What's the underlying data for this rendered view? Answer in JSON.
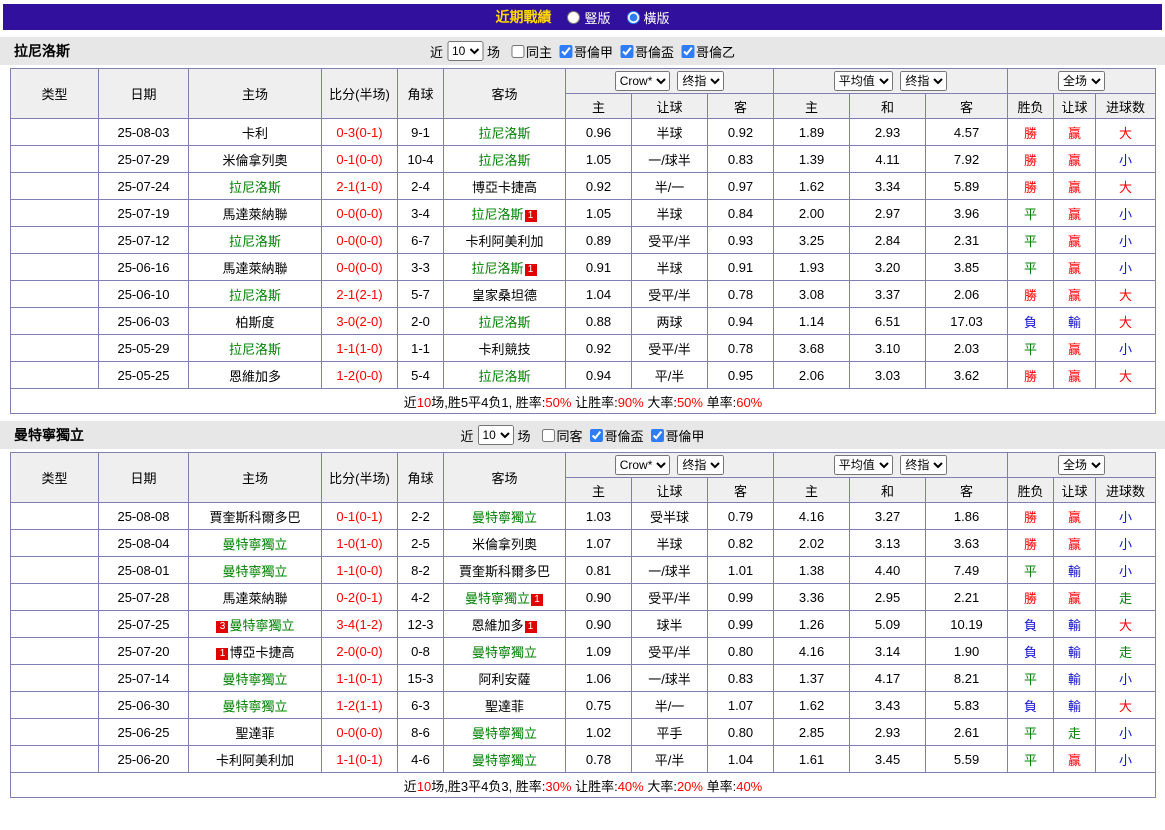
{
  "topbar": {
    "title": "近期戰績",
    "radio_vertical": "豎版",
    "radio_horizontal": "橫版",
    "vertical_checked": false,
    "horizontal_checked": true
  },
  "colors": {
    "topbar_bg": "#30109c",
    "title_yellow": "#ffd800",
    "league_jia_red": "#d8102c",
    "league_bei_magenta": "#cc00cc",
    "win_red": "#ff0000",
    "draw_green": "#008000",
    "loss_blue": "#1414cc"
  },
  "columns": {
    "type": "类型",
    "date": "日期",
    "home": "主场",
    "score": "比分(半场)",
    "corner": "角球",
    "away": "客场",
    "h": "主",
    "line": "让球",
    "a": "客",
    "h2": "主",
    "d": "和",
    "a2": "客",
    "res": "胜负",
    "let": "让球",
    "goals": "进球数"
  },
  "selects": {
    "company": "Crow*",
    "final": "终指",
    "avg": "平均值",
    "final2": "终指",
    "scope": "全场"
  },
  "sections": [
    {
      "team": "拉尼洛斯",
      "near_label": "近",
      "rounds": "10",
      "field_label": "场",
      "filters": [
        {
          "label": "同主",
          "checked": false
        },
        {
          "label": "哥倫甲",
          "checked": true
        },
        {
          "label": "哥倫盃",
          "checked": true
        },
        {
          "label": "哥倫乙",
          "checked": true
        }
      ],
      "rows": [
        {
          "league": "哥倫甲",
          "cup": false,
          "date": "25-08-03",
          "home": {
            "name": "卡利"
          },
          "score": "0-3(0-1)",
          "corners": "9-1",
          "away": {
            "name": "拉尼洛斯",
            "green": true
          },
          "odds": [
            "0.96",
            "半球",
            "0.92",
            "1.89",
            "2.93",
            "4.57"
          ],
          "res": {
            "t": "勝",
            "c": "r"
          },
          "let": {
            "t": "赢",
            "c": "r"
          },
          "goal": {
            "t": "大",
            "c": "r"
          }
        },
        {
          "league": "哥倫甲",
          "cup": false,
          "date": "25-07-29",
          "home": {
            "name": "米倫拿列奧"
          },
          "score": "0-1(0-0)",
          "corners": "10-4",
          "away": {
            "name": "拉尼洛斯",
            "green": true
          },
          "odds": [
            "1.05",
            "一/球半",
            "0.83",
            "1.39",
            "4.11",
            "7.92"
          ],
          "res": {
            "t": "勝",
            "c": "r"
          },
          "let": {
            "t": "赢",
            "c": "r"
          },
          "goal": {
            "t": "小",
            "c": "b"
          }
        },
        {
          "league": "哥倫甲",
          "cup": false,
          "date": "25-07-24",
          "home": {
            "name": "拉尼洛斯",
            "green": true
          },
          "score": "2-1(1-0)",
          "corners": "2-4",
          "away": {
            "name": "博亞卡捷高"
          },
          "odds": [
            "0.92",
            "半/一",
            "0.97",
            "1.62",
            "3.34",
            "5.89"
          ],
          "res": {
            "t": "勝",
            "c": "r"
          },
          "let": {
            "t": "赢",
            "c": "r"
          },
          "goal": {
            "t": "大",
            "c": "r"
          }
        },
        {
          "league": "哥倫甲",
          "cup": false,
          "date": "25-07-19",
          "home": {
            "name": "馬達萊納聯"
          },
          "score": "0-0(0-0)",
          "corners": "3-4",
          "away": {
            "name": "拉尼洛斯",
            "green": true,
            "rc_after": "1"
          },
          "odds": [
            "1.05",
            "半球",
            "0.84",
            "2.00",
            "2.97",
            "3.96"
          ],
          "res": {
            "t": "平",
            "c": "g"
          },
          "let": {
            "t": "赢",
            "c": "r"
          },
          "goal": {
            "t": "小",
            "c": "b"
          }
        },
        {
          "league": "哥倫甲",
          "cup": false,
          "date": "25-07-12",
          "home": {
            "name": "拉尼洛斯",
            "green": true
          },
          "score": "0-0(0-0)",
          "corners": "6-7",
          "away": {
            "name": "卡利阿美利加"
          },
          "odds": [
            "0.89",
            "受平/半",
            "0.93",
            "3.25",
            "2.84",
            "2.31"
          ],
          "res": {
            "t": "平",
            "c": "g"
          },
          "let": {
            "t": "赢",
            "c": "r"
          },
          "goal": {
            "t": "小",
            "c": "b"
          }
        },
        {
          "league": "哥倫盃",
          "cup": true,
          "date": "25-06-16",
          "home": {
            "name": "馬達萊納聯"
          },
          "score": "0-0(0-0)",
          "corners": "3-3",
          "away": {
            "name": "拉尼洛斯",
            "green": true,
            "rc_after": "1"
          },
          "odds": [
            "0.91",
            "半球",
            "0.91",
            "1.93",
            "3.20",
            "3.85"
          ],
          "res": {
            "t": "平",
            "c": "g"
          },
          "let": {
            "t": "赢",
            "c": "r"
          },
          "goal": {
            "t": "小",
            "c": "b"
          }
        },
        {
          "league": "哥倫甲",
          "cup": false,
          "date": "25-06-10",
          "home": {
            "name": "拉尼洛斯",
            "green": true
          },
          "score": "2-1(2-1)",
          "corners": "5-7",
          "away": {
            "name": "皇家桑坦德"
          },
          "odds": [
            "1.04",
            "受平/半",
            "0.78",
            "3.08",
            "3.37",
            "2.06"
          ],
          "res": {
            "t": "勝",
            "c": "r"
          },
          "let": {
            "t": "赢",
            "c": "r"
          },
          "goal": {
            "t": "大",
            "c": "r"
          }
        },
        {
          "league": "哥倫盃",
          "cup": true,
          "date": "25-06-03",
          "home": {
            "name": "柏斯度"
          },
          "score": "3-0(2-0)",
          "corners": "2-0",
          "away": {
            "name": "拉尼洛斯",
            "green": true
          },
          "odds": [
            "0.88",
            "两球",
            "0.94",
            "1.14",
            "6.51",
            "17.03"
          ],
          "res": {
            "t": "負",
            "c": "b"
          },
          "let": {
            "t": "輸",
            "c": "b"
          },
          "goal": {
            "t": "大",
            "c": "r"
          }
        },
        {
          "league": "哥倫盃",
          "cup": true,
          "date": "25-05-29",
          "home": {
            "name": "拉尼洛斯",
            "green": true
          },
          "score": "1-1(1-0)",
          "corners": "1-1",
          "away": {
            "name": "卡利競技"
          },
          "odds": [
            "0.92",
            "受平/半",
            "0.78",
            "3.68",
            "3.10",
            "2.03"
          ],
          "res": {
            "t": "平",
            "c": "g"
          },
          "let": {
            "t": "赢",
            "c": "r"
          },
          "goal": {
            "t": "小",
            "c": "b"
          }
        },
        {
          "league": "哥倫甲",
          "cup": false,
          "date": "25-05-25",
          "home": {
            "name": "恩維加多"
          },
          "score": "1-2(0-0)",
          "corners": "5-4",
          "away": {
            "name": "拉尼洛斯",
            "green": true
          },
          "odds": [
            "0.94",
            "平/半",
            "0.95",
            "2.06",
            "3.03",
            "3.62"
          ],
          "res": {
            "t": "勝",
            "c": "r"
          },
          "let": {
            "t": "赢",
            "c": "r"
          },
          "goal": {
            "t": "大",
            "c": "r"
          }
        }
      ],
      "summary": [
        {
          "t": "近"
        },
        {
          "t": "10",
          "c": "r"
        },
        {
          "t": "场,胜5平4负1, 胜率:"
        },
        {
          "t": "50%",
          "c": "r"
        },
        {
          "t": " 让胜率:"
        },
        {
          "t": "90%",
          "c": "r"
        },
        {
          "t": " 大率:"
        },
        {
          "t": "50%",
          "c": "r"
        },
        {
          "t": " 单率:"
        },
        {
          "t": "60%",
          "c": "r"
        }
      ]
    },
    {
      "team": "曼特寧獨立",
      "near_label": "近",
      "rounds": "10",
      "field_label": "场",
      "filters": [
        {
          "label": "同客",
          "checked": false
        },
        {
          "label": "哥倫盃",
          "checked": true
        },
        {
          "label": "哥倫甲",
          "checked": true
        }
      ],
      "rows": [
        {
          "league": "哥倫盃",
          "cup": true,
          "date": "25-08-08",
          "home": {
            "name": "賈奎斯科爾多巴"
          },
          "score": "0-1(0-1)",
          "corners": "2-2",
          "away": {
            "name": "曼特寧獨立",
            "green": true
          },
          "odds": [
            "1.03",
            "受半球",
            "0.79",
            "4.16",
            "3.27",
            "1.86"
          ],
          "res": {
            "t": "勝",
            "c": "r"
          },
          "let": {
            "t": "赢",
            "c": "r"
          },
          "goal": {
            "t": "小",
            "c": "b"
          }
        },
        {
          "league": "哥倫甲",
          "cup": false,
          "date": "25-08-04",
          "home": {
            "name": "曼特寧獨立",
            "green": true
          },
          "score": "1-0(1-0)",
          "corners": "2-5",
          "away": {
            "name": "米倫拿列奧"
          },
          "odds": [
            "1.07",
            "半球",
            "0.82",
            "2.02",
            "3.13",
            "3.63"
          ],
          "res": {
            "t": "勝",
            "c": "r"
          },
          "let": {
            "t": "赢",
            "c": "r"
          },
          "goal": {
            "t": "小",
            "c": "b"
          }
        },
        {
          "league": "哥倫盃",
          "cup": true,
          "date": "25-08-01",
          "home": {
            "name": "曼特寧獨立",
            "green": true
          },
          "score": "1-1(0-0)",
          "corners": "8-2",
          "away": {
            "name": "賈奎斯科爾多巴"
          },
          "odds": [
            "0.81",
            "一/球半",
            "1.01",
            "1.38",
            "4.40",
            "7.49"
          ],
          "res": {
            "t": "平",
            "c": "g"
          },
          "let": {
            "t": "輸",
            "c": "b"
          },
          "goal": {
            "t": "小",
            "c": "b"
          }
        },
        {
          "league": "哥倫甲",
          "cup": false,
          "date": "25-07-28",
          "home": {
            "name": "馬達萊納聯"
          },
          "score": "0-2(0-1)",
          "corners": "4-2",
          "away": {
            "name": "曼特寧獨立",
            "green": true,
            "rc_after": "1"
          },
          "odds": [
            "0.90",
            "受平/半",
            "0.99",
            "3.36",
            "2.95",
            "2.21"
          ],
          "res": {
            "t": "勝",
            "c": "r"
          },
          "let": {
            "t": "赢",
            "c": "r"
          },
          "goal": {
            "t": "走",
            "c": "g"
          }
        },
        {
          "league": "哥倫甲",
          "cup": false,
          "date": "25-07-25",
          "home": {
            "name": "曼特寧獨立",
            "green": true,
            "rc_before": "3"
          },
          "score": "3-4(1-2)",
          "corners": "12-3",
          "away": {
            "name": "恩維加多",
            "rc_after": "1"
          },
          "odds": [
            "0.90",
            "球半",
            "0.99",
            "1.26",
            "5.09",
            "10.19"
          ],
          "res": {
            "t": "負",
            "c": "b"
          },
          "let": {
            "t": "輸",
            "c": "b"
          },
          "goal": {
            "t": "大",
            "c": "r"
          }
        },
        {
          "league": "哥倫甲",
          "cup": false,
          "date": "25-07-20",
          "home": {
            "name": "博亞卡捷高",
            "rc_before": "1"
          },
          "score": "2-0(0-0)",
          "corners": "0-8",
          "away": {
            "name": "曼特寧獨立",
            "green": true
          },
          "odds": [
            "1.09",
            "受平/半",
            "0.80",
            "4.16",
            "3.14",
            "1.90"
          ],
          "res": {
            "t": "負",
            "c": "b"
          },
          "let": {
            "t": "輸",
            "c": "b"
          },
          "goal": {
            "t": "走",
            "c": "g"
          }
        },
        {
          "league": "哥倫甲",
          "cup": false,
          "date": "25-07-14",
          "home": {
            "name": "曼特寧獨立",
            "green": true
          },
          "score": "1-1(0-1)",
          "corners": "15-3",
          "away": {
            "name": "阿利安薩"
          },
          "odds": [
            "1.06",
            "一/球半",
            "0.83",
            "1.37",
            "4.17",
            "8.21"
          ],
          "res": {
            "t": "平",
            "c": "g"
          },
          "let": {
            "t": "輸",
            "c": "b"
          },
          "goal": {
            "t": "小",
            "c": "b"
          }
        },
        {
          "league": "哥倫甲",
          "cup": false,
          "date": "25-06-30",
          "home": {
            "name": "曼特寧獨立",
            "green": true
          },
          "score": "1-2(1-1)",
          "corners": "6-3",
          "away": {
            "name": "聖達菲"
          },
          "odds": [
            "0.75",
            "半/一",
            "1.07",
            "1.62",
            "3.43",
            "5.83"
          ],
          "res": {
            "t": "負",
            "c": "b"
          },
          "let": {
            "t": "輸",
            "c": "b"
          },
          "goal": {
            "t": "大",
            "c": "r"
          }
        },
        {
          "league": "哥倫甲",
          "cup": false,
          "date": "25-06-25",
          "home": {
            "name": "聖達菲"
          },
          "score": "0-0(0-0)",
          "corners": "8-6",
          "away": {
            "name": "曼特寧獨立",
            "green": true
          },
          "odds": [
            "1.02",
            "平手",
            "0.80",
            "2.85",
            "2.93",
            "2.61"
          ],
          "res": {
            "t": "平",
            "c": "g"
          },
          "let": {
            "t": "走",
            "c": "g"
          },
          "goal": {
            "t": "小",
            "c": "b"
          }
        },
        {
          "league": "哥倫甲",
          "cup": false,
          "date": "25-06-20",
          "home": {
            "name": "卡利阿美利加"
          },
          "score": "1-1(0-1)",
          "corners": "4-6",
          "away": {
            "name": "曼特寧獨立",
            "green": true
          },
          "odds": [
            "0.78",
            "平/半",
            "1.04",
            "1.61",
            "3.45",
            "5.59"
          ],
          "res": {
            "t": "平",
            "c": "g"
          },
          "let": {
            "t": "赢",
            "c": "r"
          },
          "goal": {
            "t": "小",
            "c": "b"
          }
        }
      ],
      "summary": [
        {
          "t": "近"
        },
        {
          "t": "10",
          "c": "r"
        },
        {
          "t": "场,胜3平4负3, 胜率:"
        },
        {
          "t": "30%",
          "c": "r"
        },
        {
          "t": " 让胜率:"
        },
        {
          "t": "40%",
          "c": "r"
        },
        {
          "t": " 大率:"
        },
        {
          "t": "20%",
          "c": "r"
        },
        {
          "t": " 单率:"
        },
        {
          "t": "40%",
          "c": "r"
        }
      ]
    }
  ]
}
